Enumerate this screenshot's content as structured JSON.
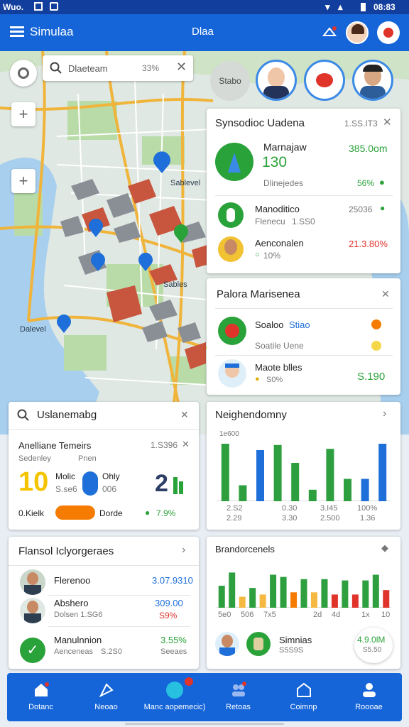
{
  "statusbar": {
    "left": "Wuo.",
    "time": "08:83"
  },
  "appbar": {
    "title": "Simulaa",
    "center": "Dlaa"
  },
  "search": {
    "value": "Dlaeteam",
    "badge": "33%"
  },
  "map": {
    "labels": [
      "Sablevel",
      "Sables",
      "Dalevel"
    ],
    "bubble": "Stabo"
  },
  "card_district": {
    "title": "Synsodioc Uadena",
    "code": "1.SS.IT3",
    "main": {
      "name": "Marnajaw",
      "value": "130",
      "amount": "385.0om",
      "sub": "Dlinejedes",
      "pct": "56%"
    },
    "row1": {
      "name": "Manoditico",
      "sub": "Flenecu",
      "sub2": "1.SS0",
      "value": "25036"
    },
    "row2": {
      "name": "Aenconalen",
      "sub": "10%",
      "value": "21.3.80%"
    }
  },
  "card_people": {
    "title": "Palora Marisenea",
    "row1": {
      "name": "Soaloo",
      "tag": "Stiao"
    },
    "row2": {
      "name": "Soatile Uene"
    },
    "row3": {
      "name": "Maote blles",
      "sub": "S0%",
      "value": "S.190"
    }
  },
  "card_search": {
    "title": "Uslanemabg",
    "header": "Anelliane Temeirs",
    "code": "1.S396",
    "tabs": [
      "Sedenley",
      "Pnen"
    ],
    "big1": "10",
    "mid1": "Molic",
    "mid1b": "S.se6",
    "mid2": "Ohly",
    "mid2b": "006",
    "big2": "2",
    "foot_left": "0.Kielk",
    "foot_btn": "",
    "foot_mid": "Dorde",
    "foot_pct": "7.9%"
  },
  "card_neighborhood": {
    "title": "Neighendomny",
    "ylabel": "1e600",
    "xlabels": [
      "2.S2",
      "0.30",
      "3.I45",
      "100%"
    ],
    "xlabels2": [
      "2.29",
      "3.30",
      "2.500",
      "1.36"
    ]
  },
  "card_financial": {
    "title": "Flansol Iclyorgeraes",
    "row1": {
      "name": "Flerenoo",
      "value": "3.07.9310"
    },
    "row2": {
      "name": "Abshero",
      "sub": "Dolsen 1.SG6",
      "value": "309.00",
      "value2": "S9%"
    },
    "row3": {
      "name": "Manulnnion",
      "sub": "Aenceneas",
      "sub2": "S.2S0",
      "value": "3.55%",
      "value2": "Seeaes"
    }
  },
  "card_breakdown": {
    "title": "Brandorcenels",
    "xlabels": [
      "5e0",
      "506",
      "7x5",
      "2d",
      "4d",
      "1x",
      "10"
    ],
    "foot_name": "Simnias",
    "foot_sub": "S5S9S",
    "foot_value": "4.9.0lM",
    "foot_value2": "S5.50"
  },
  "nav": [
    "Dotanc",
    "Neoao",
    "Manc aopemecic)",
    "Retoas",
    "Coimnp",
    "Roooae"
  ],
  "colors": {
    "primary": "#1565d8",
    "dark": "#123e9e",
    "green": "#2aa23a",
    "red": "#e0342b",
    "orange": "#f57c00"
  },
  "chart_data": [
    {
      "type": "bar",
      "title": "Neighendomny",
      "categories": [
        "1",
        "2",
        "3",
        "4",
        "5",
        "6",
        "7",
        "8",
        "9",
        "10"
      ],
      "series": [
        {
          "name": "",
          "values": [
            90,
            25,
            80,
            88,
            60,
            18,
            82,
            35,
            35,
            90
          ]
        }
      ],
      "colors": [
        "#2e9f3e",
        "#2e9f3e",
        "#1e6fd9",
        "#2e9f3e",
        "#2e9f3e",
        "#2e9f3e",
        "#2e9f3e",
        "#2e9f3e",
        "#1e6fd9",
        "#1e6fd9"
      ],
      "ylim": [
        0,
        100
      ]
    },
    {
      "type": "bar",
      "title": "Brandorcenels",
      "categories": [
        "1",
        "2",
        "3",
        "4",
        "5",
        "6",
        "7",
        "8",
        "9",
        "10",
        "11",
        "12",
        "13",
        "14",
        "15",
        "16",
        "17"
      ],
      "series": [
        {
          "name": "",
          "values": [
            50,
            80,
            25,
            45,
            30,
            75,
            70,
            35,
            65,
            35,
            65,
            30,
            62,
            30,
            62,
            75,
            40
          ]
        }
      ],
      "colors": [
        "#2e9f3e",
        "#2e9f3e",
        "#f5b942",
        "#2e9f3e",
        "#f5b942",
        "#2e9f3e",
        "#2e9f3e",
        "#f57c00",
        "#2e9f3e",
        "#f5b942",
        "#2e9f3e",
        "#e0342b",
        "#2e9f3e",
        "#e0342b",
        "#2e9f3e",
        "#2e9f3e",
        "#e0342b"
      ],
      "ylim": [
        0,
        100
      ]
    }
  ]
}
